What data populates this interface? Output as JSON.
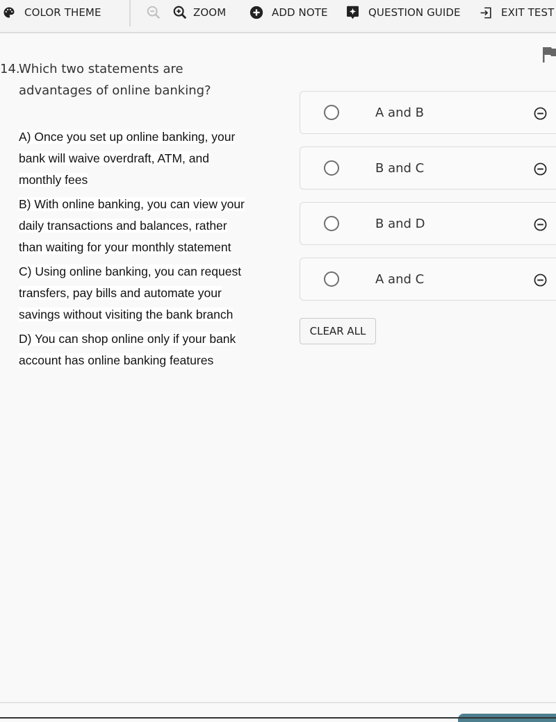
{
  "toolbar": {
    "color_theme": "COLOR THEME",
    "zoom_out_icon": "zoom-out-icon",
    "zoom": "ZOOM",
    "add_note": "ADD NOTE",
    "question_guide": "QUESTION GUIDE",
    "exit_test": "EXIT TEST"
  },
  "question": {
    "number": "14.",
    "text_line1": "Which two statements are",
    "text_line2": "advantages of online banking?",
    "statements": [
      "A) Once you set up online banking, your bank will waive overdraft, ATM, and monthly fees",
      "B) With online banking, you can view your daily transactions and balances, rather than waiting for your monthly statement",
      "C) Using online banking, you can request transfers, pay bills and automate your savings without visiting the bank branch",
      "D) You can shop online only if your bank account has online banking features"
    ]
  },
  "options": [
    {
      "label": "A and B",
      "selected": false
    },
    {
      "label": "B and C",
      "selected": false
    },
    {
      "label": "B and D",
      "selected": false
    },
    {
      "label": "A and C",
      "selected": false
    }
  ],
  "clear_all": "CLEAR ALL",
  "colors": {
    "accent_button": "#4d7f8e",
    "background": "#f9f9f9",
    "toolbar": "#f4f4f4"
  }
}
